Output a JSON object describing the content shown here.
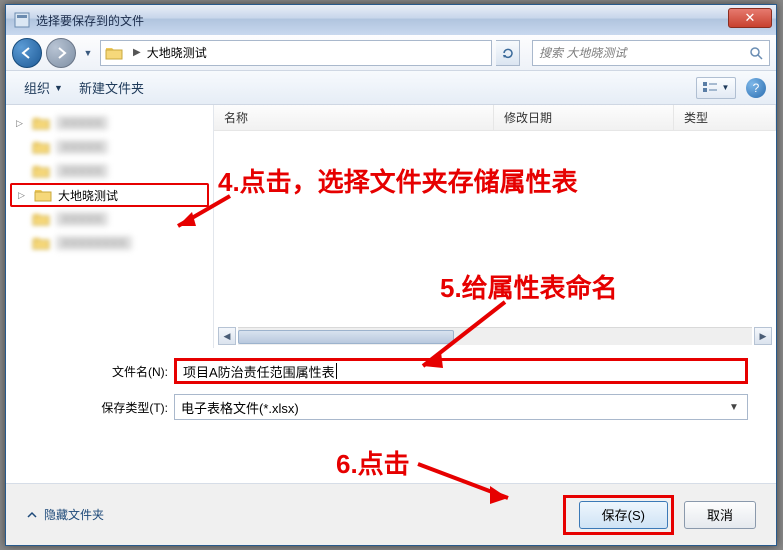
{
  "title": "选择要保存到的文件",
  "nav": {
    "crumb1": "大地晓测试",
    "search_placeholder": "搜索 大地晓测试"
  },
  "toolbar": {
    "organize": "组织",
    "newfolder": "新建文件夹"
  },
  "columns": {
    "name": "名称",
    "date": "修改日期",
    "type": "类型"
  },
  "tree": {
    "selected": "大地晓测试"
  },
  "fields": {
    "filename_label": "文件名(N):",
    "filename_value": "项目A防治责任范围属性表",
    "savetype_label": "保存类型(T):",
    "savetype_value": "电子表格文件(*.xlsx)"
  },
  "footer": {
    "hide": "隐藏文件夹",
    "save": "保存(S)",
    "cancel": "取消"
  },
  "annotations": {
    "a4": "4.点击，选择文件夹存储属性表",
    "a5": "5.给属性表命名",
    "a6": "6.点击"
  }
}
